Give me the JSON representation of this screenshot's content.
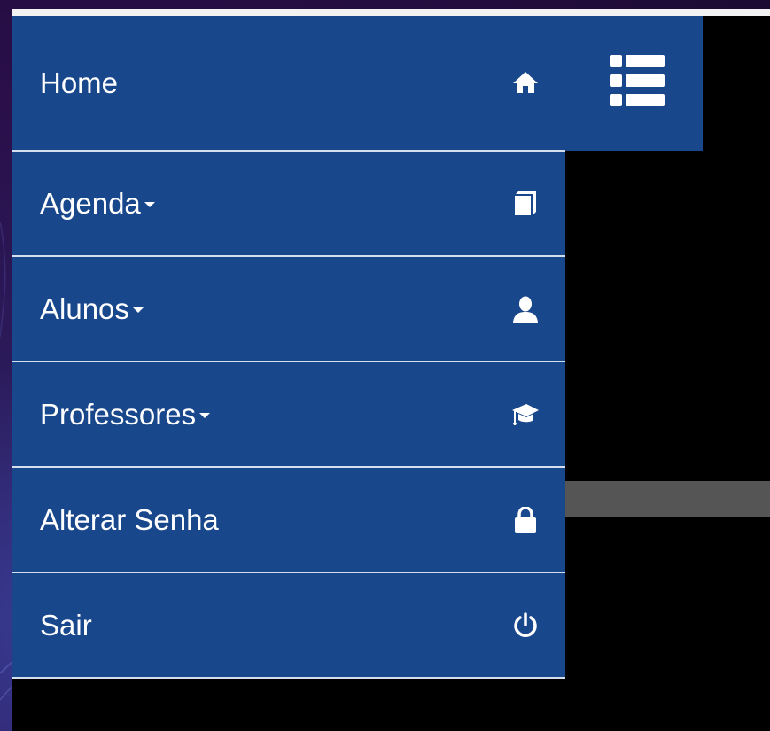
{
  "menu": {
    "home": {
      "label": "Home",
      "icon": "home-icon"
    },
    "items": [
      {
        "label": "Agenda",
        "has_dropdown": true,
        "icon": "book-icon"
      },
      {
        "label": "Alunos",
        "has_dropdown": true,
        "icon": "user-icon"
      },
      {
        "label": "Professores",
        "has_dropdown": true,
        "icon": "graduation-cap-icon"
      },
      {
        "label": "Alterar Senha",
        "has_dropdown": false,
        "icon": "lock-icon"
      },
      {
        "label": "Sair",
        "has_dropdown": false,
        "icon": "power-icon"
      }
    ],
    "toggle": {
      "icon": "list-icon"
    }
  },
  "colors": {
    "menu_background": "#19478c",
    "divider": "#d5deec",
    "text": "#ffffff",
    "content_background": "#000000",
    "strip": "#555555"
  }
}
